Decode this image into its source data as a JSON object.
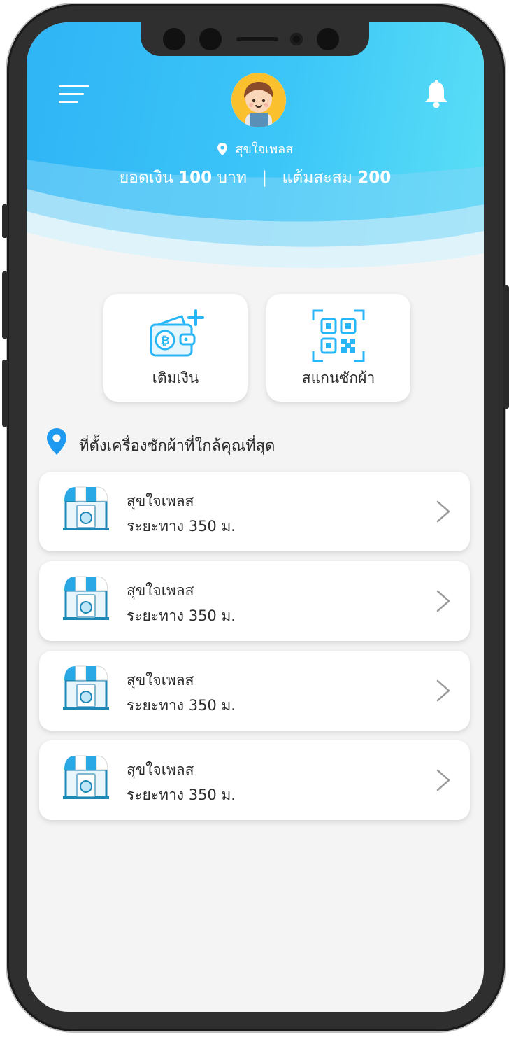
{
  "header": {
    "location_name": "สุขใจเพลส",
    "balance_prefix": "ยอดเงิน",
    "balance_value": "100",
    "balance_unit": "บาท",
    "separator": "|",
    "points_prefix": "แต้มสะสม",
    "points_value": "200",
    "icons": [
      "menu-icon",
      "avatar",
      "location-pin-icon",
      "bell-icon"
    ]
  },
  "actions": [
    {
      "label": "เติมเงิน",
      "icon": "wallet-topup-icon"
    },
    {
      "label": "สแกนซักผ้า",
      "icon": "qr-scan-icon"
    }
  ],
  "section": {
    "title": "ที่ตั้งเครื่องซักผ้าที่ใกล้คุณที่สุด",
    "icon": "location-pin-icon"
  },
  "shops": [
    {
      "name": "สุขใจเพลส",
      "distance": "ระยะทาง 350 ม."
    },
    {
      "name": "สุขใจเพลส",
      "distance": "ระยะทาง 350 ม."
    },
    {
      "name": "สุขใจเพลส",
      "distance": "ระยะทาง 350 ม."
    },
    {
      "name": "สุขใจเพลส",
      "distance": "ระยะทาง 350 ม."
    }
  ],
  "colors": {
    "accent": "#2fb4f5",
    "icon_blue": "#29b6f6",
    "pin_blue": "#1e9bf0"
  }
}
